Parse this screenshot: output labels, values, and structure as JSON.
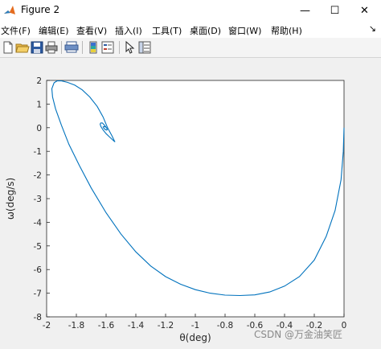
{
  "window": {
    "title": "Figure 2",
    "minimize_glyph": "—",
    "maximize_glyph": "☐",
    "close_glyph": "✕"
  },
  "menu": [
    "文件(F)",
    "编辑(E)",
    "查看(V)",
    "插入(I)",
    "工具(T)",
    "桌面(D)",
    "窗口(W)",
    "帮助(H)"
  ],
  "menu_pin_glyph": "↘",
  "toolbar": [
    "new-file-icon",
    "open-folder-icon",
    "save-icon",
    "print-icon",
    "print-preview-icon",
    "colorbar-icon",
    "legend-icon",
    "edit-plot-arrow-icon",
    "property-inspector-icon"
  ],
  "colors": {
    "line": "#0072bd",
    "axes_bg": "#ffffff",
    "figure_bg": "#f0f0f0"
  },
  "watermark": "CSDN @万金油笑匠",
  "chart_data": {
    "type": "line",
    "xlabel": "θ(deg)",
    "ylabel": "ω(deg/s)",
    "xlim": [
      -2,
      0
    ],
    "ylim": [
      -8,
      2
    ],
    "xticks": [
      "-2",
      "-1.8",
      "-1.6",
      "-1.4",
      "-1.2",
      "-1",
      "-0.8",
      "-0.6",
      "-0.4",
      "-0.2",
      "0"
    ],
    "yticks": [
      "2",
      "1",
      "0",
      "-1",
      "-2",
      "-3",
      "-4",
      "-5",
      "-6",
      "-7",
      "-8"
    ],
    "grid": false,
    "series": [
      {
        "x": [
          0,
          -0.005,
          -0.02,
          -0.06,
          -0.12,
          -0.2,
          -0.3,
          -0.4,
          -0.5,
          -0.6,
          -0.7,
          -0.8,
          -0.9,
          -1.0,
          -1.1,
          -1.2,
          -1.3,
          -1.4,
          -1.5,
          -1.6,
          -1.7,
          -1.78,
          -1.85,
          -1.9,
          -1.94,
          -1.96,
          -1.965,
          -1.95,
          -1.93,
          -1.9,
          -1.86,
          -1.81,
          -1.76,
          -1.71,
          -1.66,
          -1.62,
          -1.59,
          -1.56,
          -1.545,
          -1.54,
          -1.55,
          -1.575,
          -1.6,
          -1.62,
          -1.635,
          -1.64,
          -1.636,
          -1.625,
          -1.61,
          -1.598,
          -1.592,
          -1.595,
          -1.605,
          -1.615,
          -1.62,
          -1.615,
          -1.608,
          -1.603
        ],
        "y": [
          0,
          -1.0,
          -2.2,
          -3.5,
          -4.6,
          -5.6,
          -6.3,
          -6.7,
          -6.95,
          -7.07,
          -7.1,
          -7.08,
          -7.0,
          -6.85,
          -6.62,
          -6.3,
          -5.85,
          -5.25,
          -4.5,
          -3.6,
          -2.55,
          -1.6,
          -0.7,
          0.1,
          0.8,
          1.3,
          1.65,
          1.9,
          1.98,
          1.98,
          1.92,
          1.8,
          1.6,
          1.3,
          0.9,
          0.45,
          0.0,
          -0.35,
          -0.55,
          -0.6,
          -0.55,
          -0.4,
          -0.25,
          -0.1,
          0.05,
          0.15,
          0.2,
          0.2,
          0.1,
          0.0,
          -0.07,
          -0.1,
          -0.08,
          -0.02,
          0.03,
          0.05,
          0.04,
          0.02
        ]
      }
    ]
  }
}
